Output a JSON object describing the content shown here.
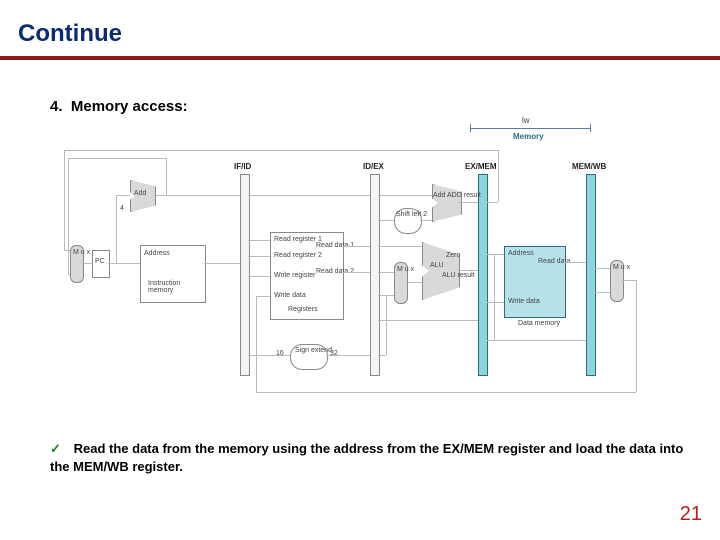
{
  "title": "Continue",
  "section": {
    "number": "4.",
    "label": "Memory access:"
  },
  "bullet": {
    "checkmark": "✓",
    "text": "Read the data from the memory using the address from the EX/MEM register and load the data into the MEM/WB register."
  },
  "page_number": "21",
  "diagram": {
    "stage_labels": {
      "if_id": "IF/ID",
      "id_ex": "ID/EX",
      "ex_mem": "EX/MEM",
      "mem_wb": "MEM/WB"
    },
    "annotation": {
      "instr": "lw",
      "stage": "Memory"
    },
    "blocks": {
      "pc": "PC",
      "instr_mem": "Instruction\nmemory",
      "instr_mem_port": "Address",
      "regfile": "Registers",
      "rf_ports": {
        "rr1": "Read register 1",
        "rr2": "Read register 2",
        "wr": "Write register",
        "wd": "Write data",
        "rd1": "Read data 1",
        "rd2": "Read data 2"
      },
      "sign_ext": "Sign extend",
      "sign_in": "16",
      "sign_out": "32",
      "shift": "Shift left 2",
      "add_pc": "Add",
      "add_br": "Add ADD result",
      "alu": "ALU",
      "alu_res": "ALU result",
      "zero": "Zero",
      "dmem": "Data memory",
      "dmem_ports": {
        "addr": "Address",
        "wd": "Write data",
        "rd": "Read data"
      },
      "mux": "M\nu\nx"
    }
  }
}
